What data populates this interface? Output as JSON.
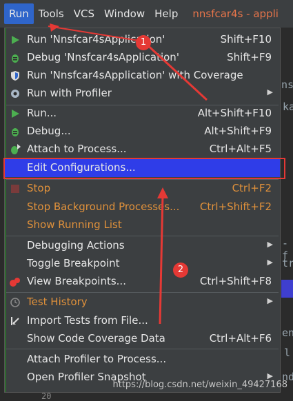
{
  "menubar": {
    "items": [
      "Run",
      "Tools",
      "VCS",
      "Window",
      "Help"
    ],
    "title": "nnsfcar4s - appli"
  },
  "background_fragments": [
    "nsfc",
    "ka",
    "-f",
    "tr",
    "en",
    "l",
    "nd"
  ],
  "menu": {
    "items": [
      {
        "label": "Run 'Nnsfcar4sApplication'",
        "shortcut": "Shift+F10",
        "icon": "run-green-icon"
      },
      {
        "label": "Debug 'Nnsfcar4sApplication'",
        "shortcut": "Shift+F9",
        "icon": "debug-bug-icon"
      },
      {
        "label": "Run 'Nnsfcar4sApplication' with Coverage",
        "shortcut": "",
        "icon": "coverage-shield-icon"
      },
      {
        "label": "Run with Profiler",
        "shortcut": "",
        "icon": "profiler-icon",
        "submenu": true
      },
      {
        "label": "Run...",
        "shortcut": "Alt+Shift+F10",
        "icon": "run-green-icon"
      },
      {
        "label": "Debug...",
        "shortcut": "Alt+Shift+F9",
        "icon": "debug-bug-icon"
      },
      {
        "label": "Attach to Process...",
        "shortcut": "Ctrl+Alt+F5",
        "icon": "attach-bug-icon"
      },
      {
        "label": "Edit Configurations...",
        "shortcut": "",
        "icon": "",
        "selected": true
      },
      {
        "label": "Stop",
        "shortcut": "Ctrl+F2",
        "icon": "stop-square-icon",
        "disabled": true
      },
      {
        "label": "Stop Background Processes...",
        "shortcut": "Ctrl+Shift+F2",
        "icon": "",
        "disabled": true
      },
      {
        "label": "Show Running List",
        "shortcut": "",
        "icon": "",
        "disabled": true
      },
      {
        "label": "Debugging Actions",
        "shortcut": "",
        "icon": "",
        "submenu": true
      },
      {
        "label": "Toggle Breakpoint",
        "shortcut": "",
        "icon": "",
        "submenu": true
      },
      {
        "label": "View Breakpoints...",
        "shortcut": "Ctrl+Shift+F8",
        "icon": "breakpoints-icon"
      },
      {
        "label": "Test History",
        "shortcut": "",
        "icon": "history-clock-icon",
        "submenu": true,
        "disabled": true
      },
      {
        "label": "Import Tests from File...",
        "shortcut": "",
        "icon": "import-tests-icon"
      },
      {
        "label": "Show Code Coverage Data",
        "shortcut": "Ctrl+Alt+F6",
        "icon": ""
      },
      {
        "label": "Attach Profiler to Process...",
        "shortcut": "",
        "icon": ""
      },
      {
        "label": "Open Profiler Snapshot",
        "shortcut": "",
        "icon": "",
        "submenu": true
      }
    ]
  },
  "annotations": {
    "badge1": "1",
    "badge2": "2"
  },
  "watermark": "https://blog.csdn.net/weixin_49427168",
  "line_number": "20"
}
